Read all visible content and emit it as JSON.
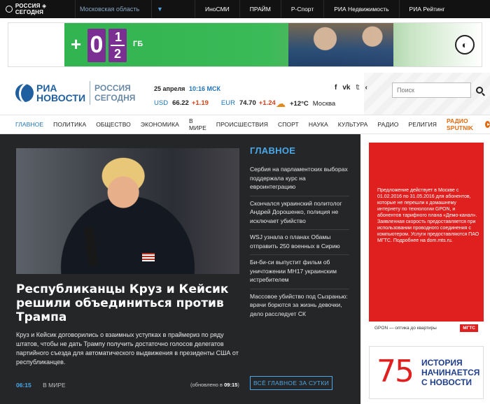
{
  "topbar": {
    "brand": "РОССИЯ ◈ СЕГОДНЯ",
    "region": "Московская область",
    "links": [
      "ИноСМИ",
      "ПРАЙМ",
      "Р-Спорт",
      "РИА Недвижимость",
      "РИА Рейтинг"
    ]
  },
  "banner": {
    "plus": "+0",
    "gb": "ГБ",
    "fraction_top": "1",
    "fraction_bottom": "2"
  },
  "header": {
    "logo_ria": "РИА",
    "logo_novosti": "НОВОСТИ",
    "logo_rs1": "РОССИЯ",
    "logo_rs2": "СЕГОДНЯ",
    "date": "25 апреля",
    "time": "10:16 МСК",
    "usd_label": "USD",
    "usd_value": "66.22",
    "usd_change": "+1.19",
    "eur_label": "EUR",
    "eur_value": "74.70",
    "eur_change": "+1.24",
    "temp": "+12°C",
    "city": "Москва",
    "search_placeholder": "Поиск"
  },
  "nav": {
    "items": [
      "ГЛАВНОЕ",
      "ПОЛИТИКА",
      "ОБЩЕСТВО",
      "ЭКОНОМИКА",
      "В МИРЕ",
      "ПРОИСШЕСТВИЯ",
      "СПОРТ",
      "НАУКА",
      "КУЛЬТУРА",
      "РАДИО",
      "РЕЛИГИЯ"
    ],
    "sputnik": "РАДИО SPUTNIK"
  },
  "hero": {
    "title": "Республиканцы Круз и Кейсик решили объединиться против Трампа",
    "lead": "Круз и Кейсик договорились о взаимных уступках в праймериз по ряду штатов, чтобы не дать Трампу получить достаточно голосов делегатов партийного съезда для автоматического выдвижения в президенты США от республиканцев.",
    "time": "06:15",
    "section": "В МИРЕ",
    "updated_prefix": "(обновлено в",
    "updated_time": "09:15",
    "updated_suffix": ")"
  },
  "sidebar": {
    "heading": "ГЛАВНОЕ",
    "items": [
      "Сербия на парламентских выборах поддержала курс на евроинтеграцию",
      "Скончался украинский политолог Андрей Дорошенко, полиция не исключает убийство",
      "WSJ узнала о планах Обамы отправить 250 военных в Сирию",
      "Би-би-си выпустит фильм об уничтожении MH17 украинским истребителем",
      "Массовое убийство под Сызранью: врачи борются за жизнь девочки, дело расследует СК"
    ],
    "all_button": "ВСЁ ГЛАВНОЕ ЗА СУТКИ"
  },
  "ads": {
    "mgts_text": "Предложение действует в Москве с 01.02.2016 по 31.05.2016 для абонентов, которые не перешли к домашнему интернету по технологии GPON, и абонентов тарифного плана «Демо-канал». Заявленная скорость предоставляется при использовании проводного соединения с компьютером. Услуги предоставляются ПАО МГТС. Подробнее на dom.mts.ru.",
    "mgts_footer": "GPON — оптика до квартиры",
    "mgts_logo": "МГТС",
    "ria75_number": "75",
    "ria75_text": "ИСТОРИЯ НАЧИНАЕТСЯ С НОВОСТИ"
  },
  "colors": {
    "accent": "#1f73b7",
    "dark_bg": "#252628",
    "sputnik": "#e06a10",
    "rate_change": "#d0451b",
    "ad_red": "#e0201f"
  }
}
